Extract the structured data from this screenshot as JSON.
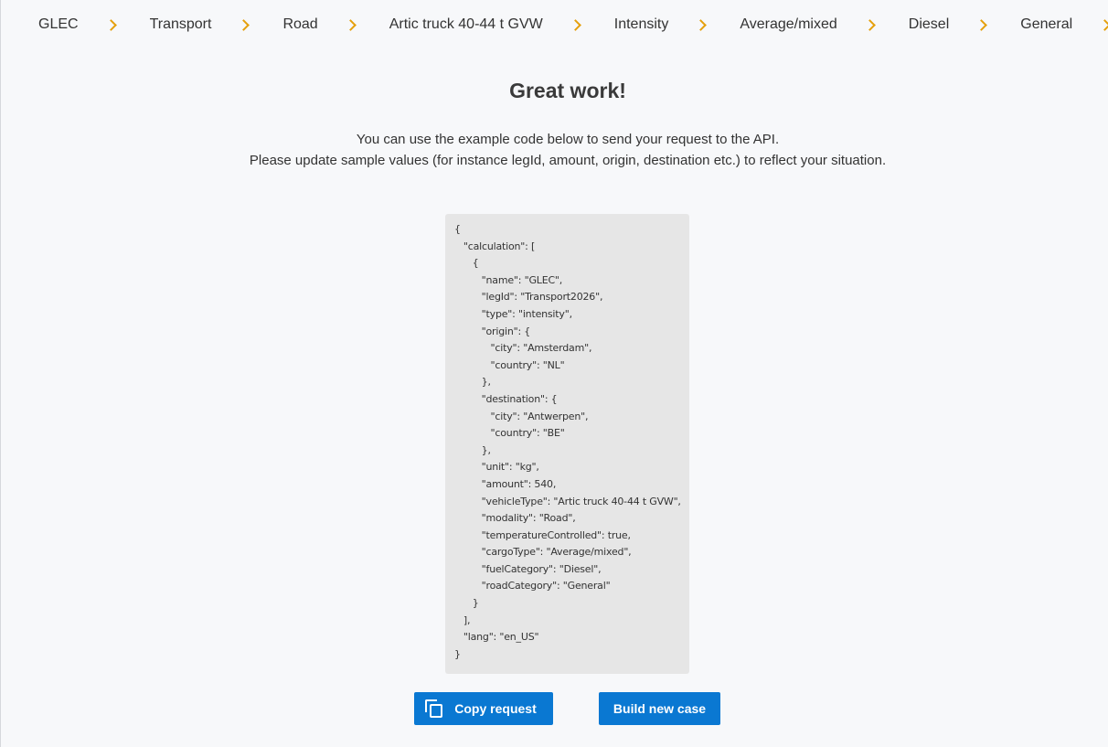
{
  "breadcrumb": {
    "items": [
      {
        "label": "GLEC"
      },
      {
        "label": "Transport"
      },
      {
        "label": "Road"
      },
      {
        "label": "Artic truck 40-44 t GVW"
      },
      {
        "label": "Intensity"
      },
      {
        "label": "Average/mixed"
      },
      {
        "label": "Diesel"
      },
      {
        "label": "General"
      }
    ],
    "separator_icon": "chevron-right-icon",
    "separator_color": "#e5a00d"
  },
  "main": {
    "title": "Great work!",
    "intro_line1": "You can use the example code below to send your request to the API.",
    "intro_line2": "Please update sample values (for instance legId, amount, origin, destination etc.) to reflect your situation.",
    "code": "{\n   \"calculation\": [\n      {\n         \"name\": \"GLEC\",\n         \"legId\": \"Transport2026\",\n         \"type\": \"intensity\",\n         \"origin\": {\n            \"city\": \"Amsterdam\",\n            \"country\": \"NL\"\n         },\n         \"destination\": {\n            \"city\": \"Antwerpen\",\n            \"country\": \"BE\"\n         },\n         \"unit\": \"kg\",\n         \"amount\": 540,\n         \"vehicleType\": \"Artic truck 40-44 t GVW\",\n         \"modality\": \"Road\",\n         \"temperatureControlled\": true,\n         \"cargoType\": \"Average/mixed\",\n         \"fuelCategory\": \"Diesel\",\n         \"roadCategory\": \"General\"\n      }\n   ],\n   \"lang\": \"en_US\"\n}"
  },
  "actions": {
    "copy_label": "Copy request",
    "copy_icon": "copy-icon",
    "new_case_label": "Build new case",
    "button_color": "#0a78d2"
  }
}
